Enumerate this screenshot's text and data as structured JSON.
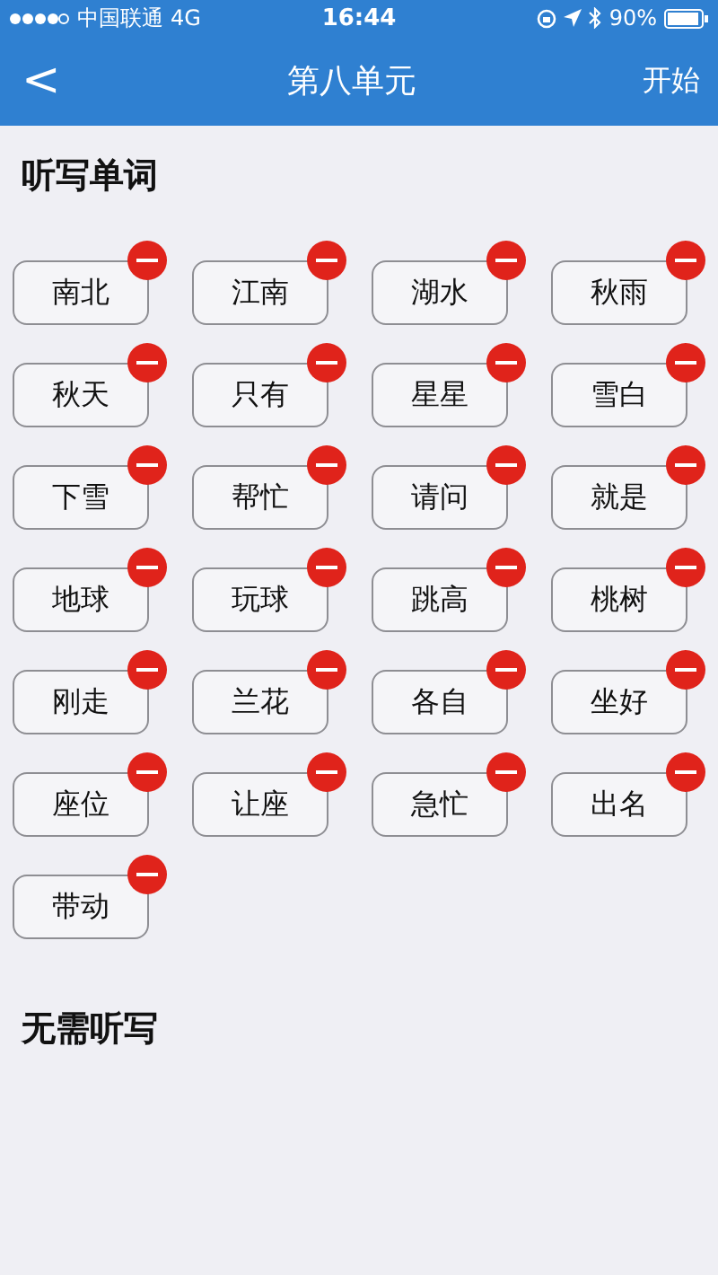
{
  "status_bar": {
    "carrier": "中国联通",
    "network": "4G",
    "time": "16:44",
    "battery": "90%"
  },
  "nav": {
    "back": "<",
    "title": "第八单元",
    "action": "开始"
  },
  "sections": [
    {
      "title": "听写单词",
      "words": [
        "南北",
        "江南",
        "湖水",
        "秋雨",
        "秋天",
        "只有",
        "星星",
        "雪白",
        "下雪",
        "帮忙",
        "请问",
        "就是",
        "地球",
        "玩球",
        "跳高",
        "桃树",
        "刚走",
        "兰花",
        "各自",
        "坐好",
        "座位",
        "让座",
        "急忙",
        "出名",
        "带动"
      ]
    },
    {
      "title": "无需听写"
    }
  ]
}
